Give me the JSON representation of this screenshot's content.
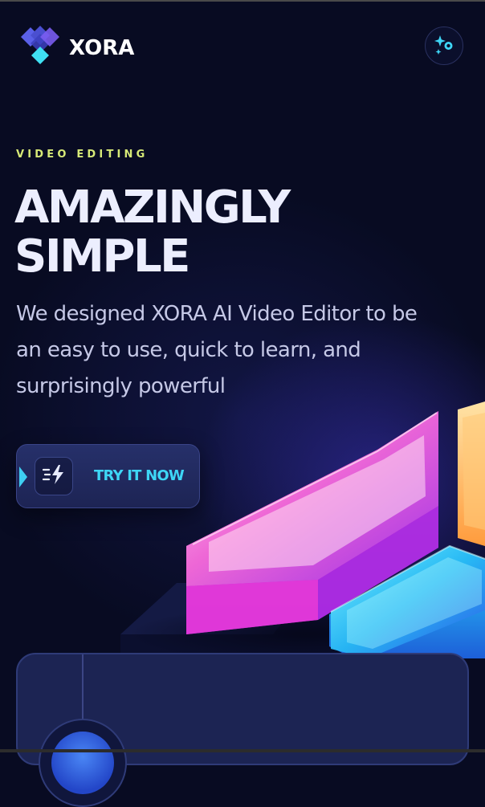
{
  "brand": {
    "name": "XORA"
  },
  "hero": {
    "eyebrow": "VIDEO EDITING",
    "title_line1": "AMAZINGLY",
    "title_line2": "SIMPLE",
    "description": "We designed XORA AI Video Editor to be an easy to use, quick to learn, and surprisingly powerful",
    "cta_label": "TRY IT NOW"
  },
  "icons": {
    "logo": "xora-logo-icon",
    "magic": "sparkle-icon",
    "cta": "zap-icon"
  },
  "colors": {
    "background": "#080b22",
    "accent_lime": "#d7ea77",
    "accent_cyan": "#3ed6f6",
    "headline": "#eceefe",
    "card": "#1c2453"
  }
}
